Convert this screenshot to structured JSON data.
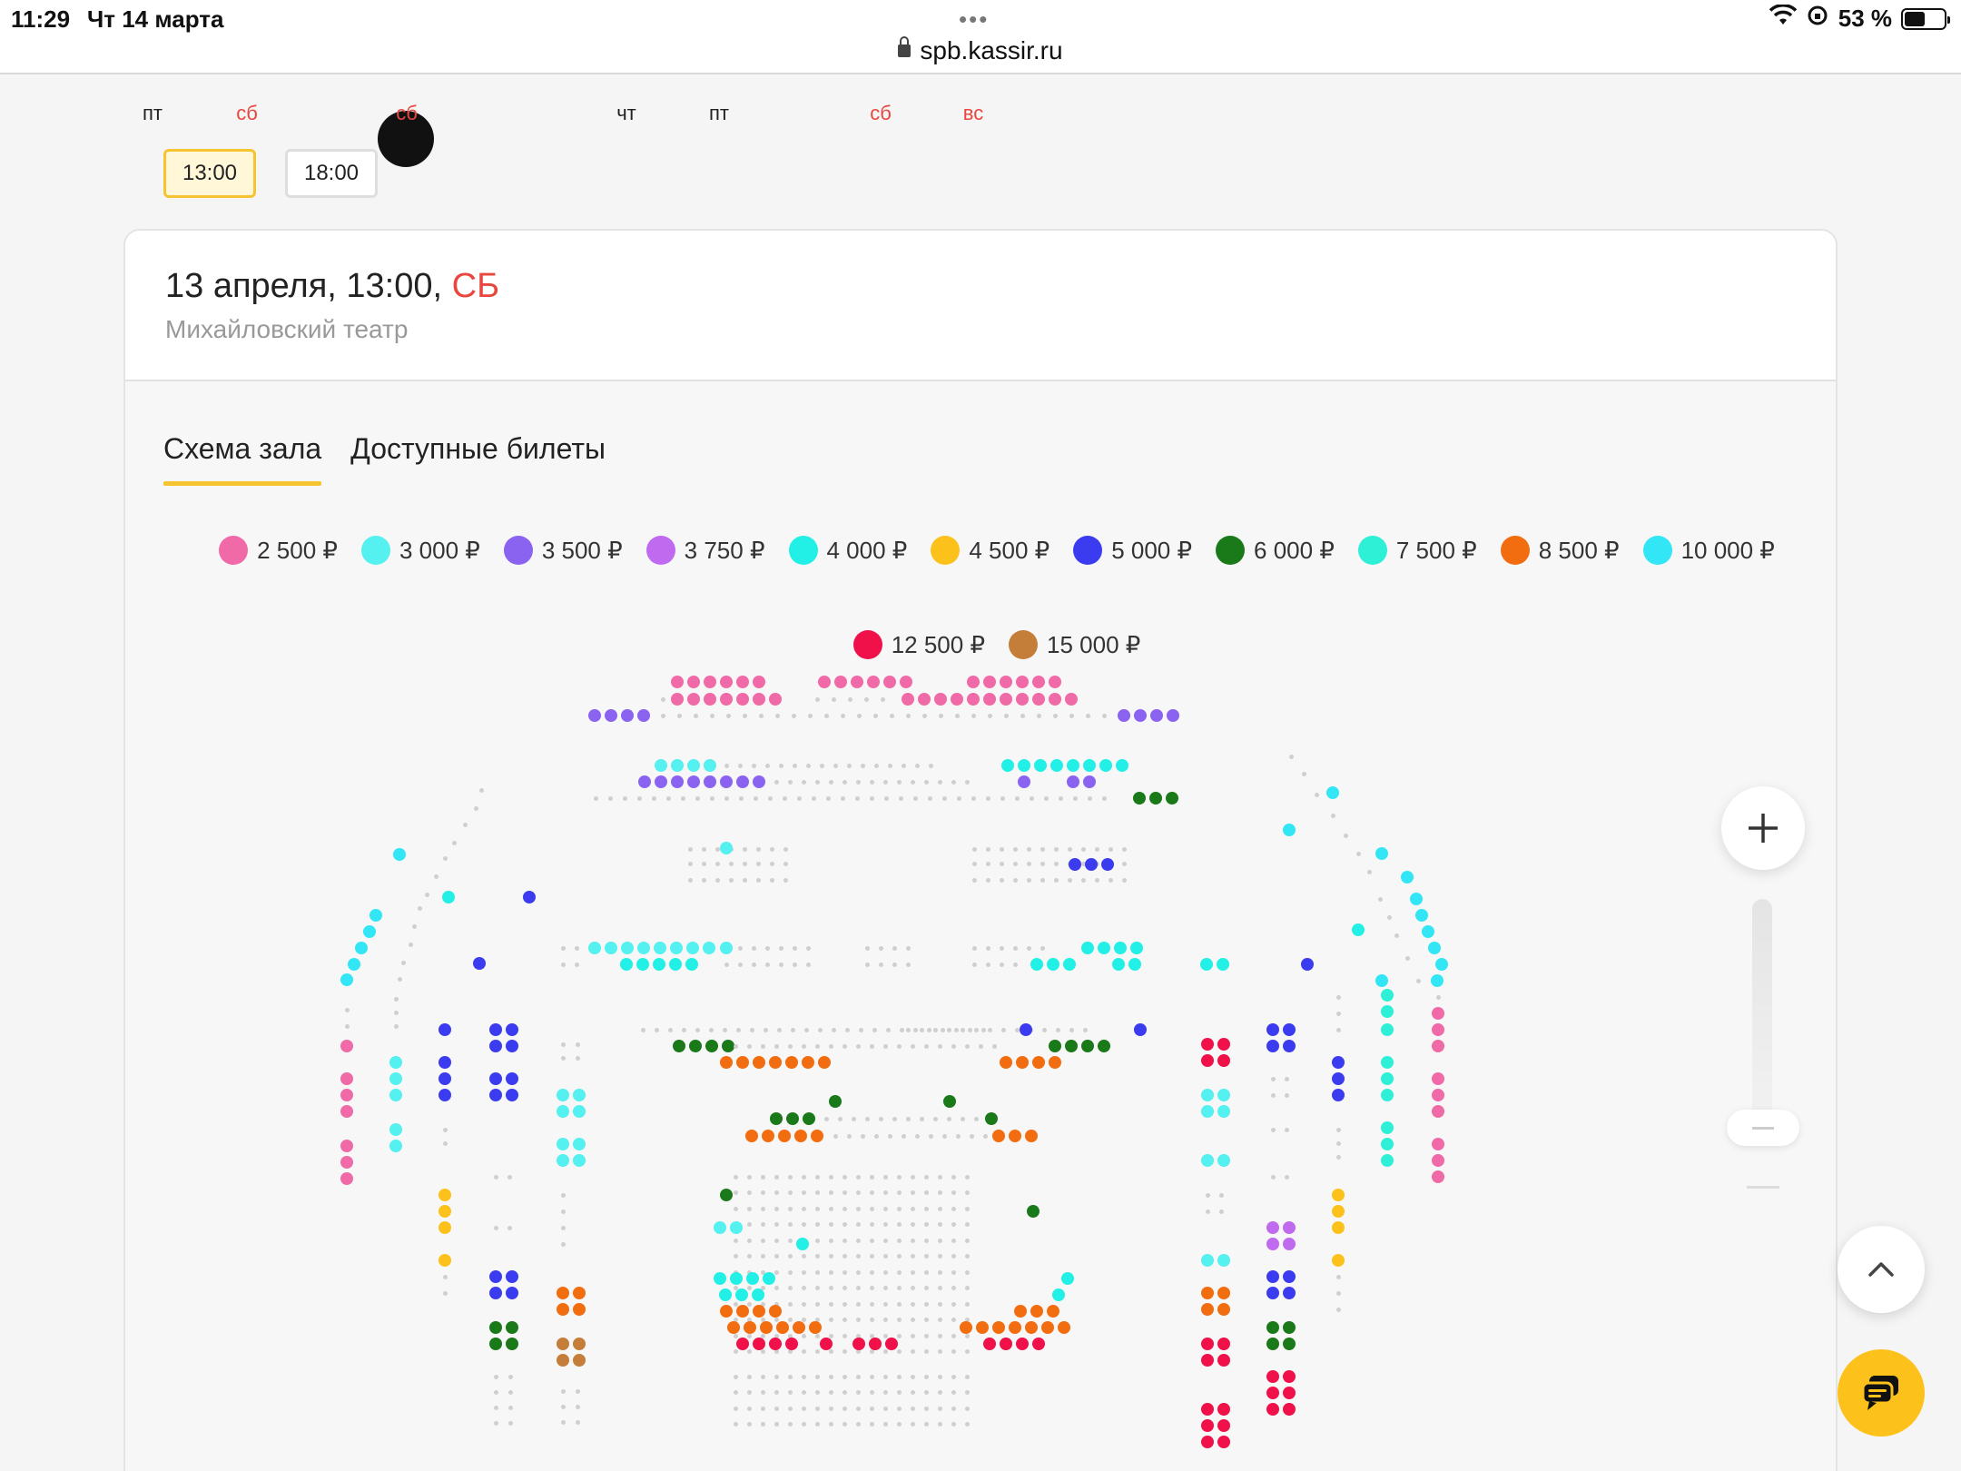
{
  "status_bar": {
    "time": "11:29",
    "date": "Чт 14 марта",
    "url": "spb.kassir.ru",
    "battery": "53 %",
    "battery_level": 0.53
  },
  "day_strip": [
    {
      "label": "пт",
      "weekend": false
    },
    {
      "label": "сб",
      "weekend": true
    },
    {
      "label": "сб",
      "weekend": true,
      "selected": true
    },
    {
      "label": "чт",
      "weekend": false
    },
    {
      "label": "пт",
      "weekend": false
    },
    {
      "label": "сб",
      "weekend": true
    },
    {
      "label": "вс",
      "weekend": true
    }
  ],
  "times": [
    {
      "label": "13:00",
      "active": true
    },
    {
      "label": "18:00",
      "active": false
    }
  ],
  "event": {
    "title": "13 апреля, 13:00,",
    "dow": "СБ",
    "venue": "Михайловский театр"
  },
  "tabs": [
    {
      "label": "Схема зала",
      "active": true
    },
    {
      "label": "Доступные билеты",
      "active": false
    }
  ],
  "legend": [
    {
      "label": "2 500 ₽",
      "color": "#f06aa8"
    },
    {
      "label": "3 000 ₽",
      "color": "#55f0f0"
    },
    {
      "label": "3 500 ₽",
      "color": "#8a63f0"
    },
    {
      "label": "3 750 ₽",
      "color": "#c06af0"
    },
    {
      "label": "4 000 ₽",
      "color": "#22f0e6"
    },
    {
      "label": "4 500 ₽",
      "color": "#fcc21b"
    },
    {
      "label": "5 000 ₽",
      "color": "#3b3bef"
    },
    {
      "label": "6 000 ₽",
      "color": "#1a7a1a"
    },
    {
      "label": "7 500 ₽",
      "color": "#2ef0d6"
    },
    {
      "label": "8 500 ₽",
      "color": "#f26d10"
    },
    {
      "label": "10 000 ₽",
      "color": "#33e6f6"
    },
    {
      "label": "12 500 ₽",
      "color": "#f0104a"
    },
    {
      "label": "15 000 ₽",
      "color": "#c47e3a"
    }
  ],
  "controls": {
    "zoom_in_icon": "plus-icon",
    "zoom_out_icon": "minus-icon",
    "scroll_up_icon": "chevron-up-icon",
    "chat_icon": "chat-icon"
  }
}
